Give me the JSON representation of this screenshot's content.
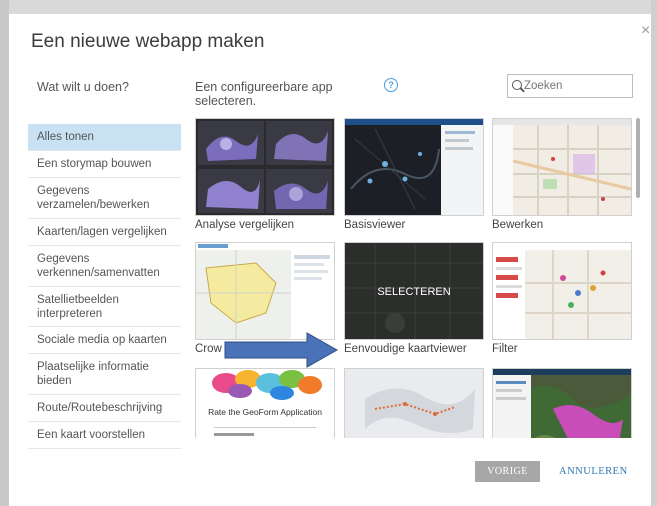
{
  "dialog": {
    "title": "Een nieuwe webapp maken",
    "close_symbol": "×"
  },
  "sidebar": {
    "heading": "Wat wilt u doen?",
    "items": [
      {
        "label": "Alles tonen",
        "active": true
      },
      {
        "label": "Een storymap bouwen"
      },
      {
        "label": "Gegevens verzamelen/bewerken"
      },
      {
        "label": "Kaarten/lagen vergelijken"
      },
      {
        "label": "Gegevens verkennen/samenvatten"
      },
      {
        "label": "Satellietbeelden interpreteren"
      },
      {
        "label": "Sociale media op kaarten"
      },
      {
        "label": "Plaatselijke informatie bieden"
      },
      {
        "label": "Route/Routebeschrijving"
      },
      {
        "label": "Een kaart voorstellen"
      }
    ]
  },
  "main": {
    "subtitle": "Een configureerbare app selecteren.",
    "help_symbol": "?",
    "search": {
      "placeholder": "Zoeken",
      "value": ""
    },
    "tiles": [
      {
        "label": "Analyse vergelijken"
      },
      {
        "label": "Basisviewer"
      },
      {
        "label": "Bewerken"
      },
      {
        "label": "Crow"
      },
      {
        "label": "Eenvoudige kaartviewer",
        "overlay": "SELECTEREN"
      },
      {
        "label": "Filter"
      },
      {
        "label": "",
        "thumb_text": "Rate the GeoForm Application"
      },
      {
        "label": ""
      },
      {
        "label": ""
      }
    ]
  },
  "footer": {
    "prev_label": "VORIGE",
    "cancel_label": "ANNULEREN"
  },
  "colors": {
    "accent": "#4a9fd9",
    "active_item": "#c8e2f4",
    "cancel_link": "#2f78b5",
    "prev_button": "#a7a7a7",
    "arrow": "#4a72b8"
  }
}
